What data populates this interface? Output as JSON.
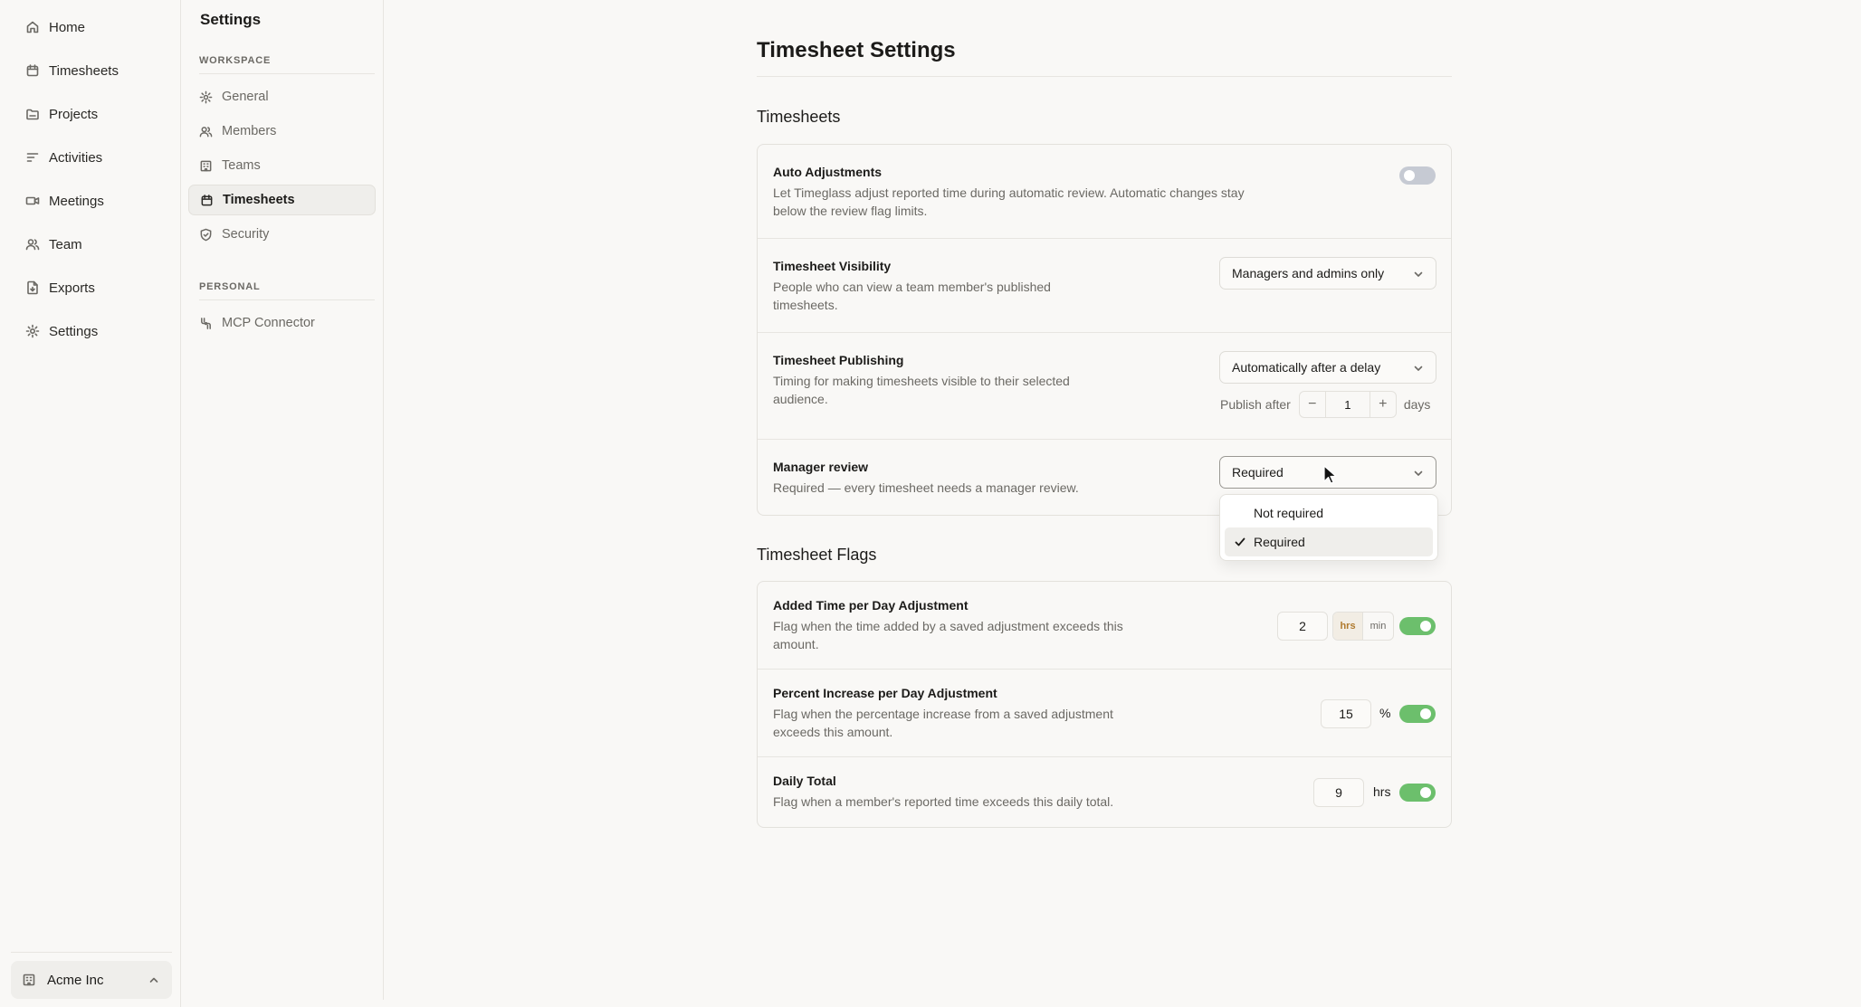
{
  "nav": {
    "items": [
      {
        "label": "Home",
        "icon": "home-icon"
      },
      {
        "label": "Timesheets",
        "icon": "calendar-icon"
      },
      {
        "label": "Projects",
        "icon": "folder-icon"
      },
      {
        "label": "Activities",
        "icon": "list-icon"
      },
      {
        "label": "Meetings",
        "icon": "video-icon"
      },
      {
        "label": "Team",
        "icon": "users-icon"
      },
      {
        "label": "Exports",
        "icon": "file-export-icon"
      },
      {
        "label": "Settings",
        "icon": "gear-icon"
      }
    ],
    "workspace": "Acme Inc"
  },
  "subnav": {
    "title": "Settings",
    "workspace_heading": "WORKSPACE",
    "workspace_items": [
      {
        "label": "General",
        "icon": "gear-icon"
      },
      {
        "label": "Members",
        "icon": "users-icon"
      },
      {
        "label": "Teams",
        "icon": "building-icon"
      },
      {
        "label": "Timesheets",
        "icon": "calendar-icon",
        "active": true
      },
      {
        "label": "Security",
        "icon": "shield-icon"
      }
    ],
    "personal_heading": "PERSONAL",
    "personal_items": [
      {
        "label": "MCP Connector",
        "icon": "connector-icon"
      }
    ]
  },
  "main": {
    "title": "Timesheet Settings",
    "timesheets_section": "Timesheets",
    "auto_adjustments": {
      "label": "Auto Adjustments",
      "desc_line1": "Let Timeglass adjust reported time during automatic review. Automatic changes stay",
      "desc_line2": "below the review flag limits.",
      "enabled": false
    },
    "visibility": {
      "label": "Timesheet Visibility",
      "desc_line1": "People who can view a team member's published",
      "desc_line2": "timesheets.",
      "value": "Managers and admins only"
    },
    "publishing": {
      "label": "Timesheet Publishing",
      "desc_line1": "Timing for making timesheets visible to their selected",
      "desc_line2": "audience.",
      "value": "Automatically after a delay",
      "publish_after_label": "Publish after",
      "minus": "−",
      "days_value": "1",
      "plus": "+",
      "days_label": "days"
    },
    "manager_review": {
      "label": "Manager review",
      "desc": "Required — every timesheet needs a manager review.",
      "value": "Required",
      "options": [
        "Not required",
        "Required"
      ],
      "selected": "Required"
    },
    "flags_section": "Timesheet Flags",
    "added_time": {
      "label": "Added Time per Day Adjustment",
      "desc_line1": "Flag when the time added by a saved adjustment exceeds this",
      "desc_line2": "amount.",
      "value": "2",
      "unit_hrs": "hrs",
      "unit_min": "min",
      "selected_unit": "hrs",
      "enabled": true
    },
    "percent_increase": {
      "label": "Percent Increase per Day Adjustment",
      "desc_line1": "Flag when the percentage increase from a saved adjustment",
      "desc_line2": "exceeds this amount.",
      "value": "15",
      "unit": "%",
      "enabled": true
    },
    "daily_total": {
      "label": "Daily Total",
      "desc": "Flag when a member's reported time exceeds this daily total.",
      "value": "9",
      "unit": "hrs",
      "enabled": true
    }
  },
  "colors": {
    "background": "#f9f8f6",
    "toggle_on": "#6cbf6c",
    "toggle_off": "#c6cad3",
    "unit_selected": "#b07a2e"
  }
}
